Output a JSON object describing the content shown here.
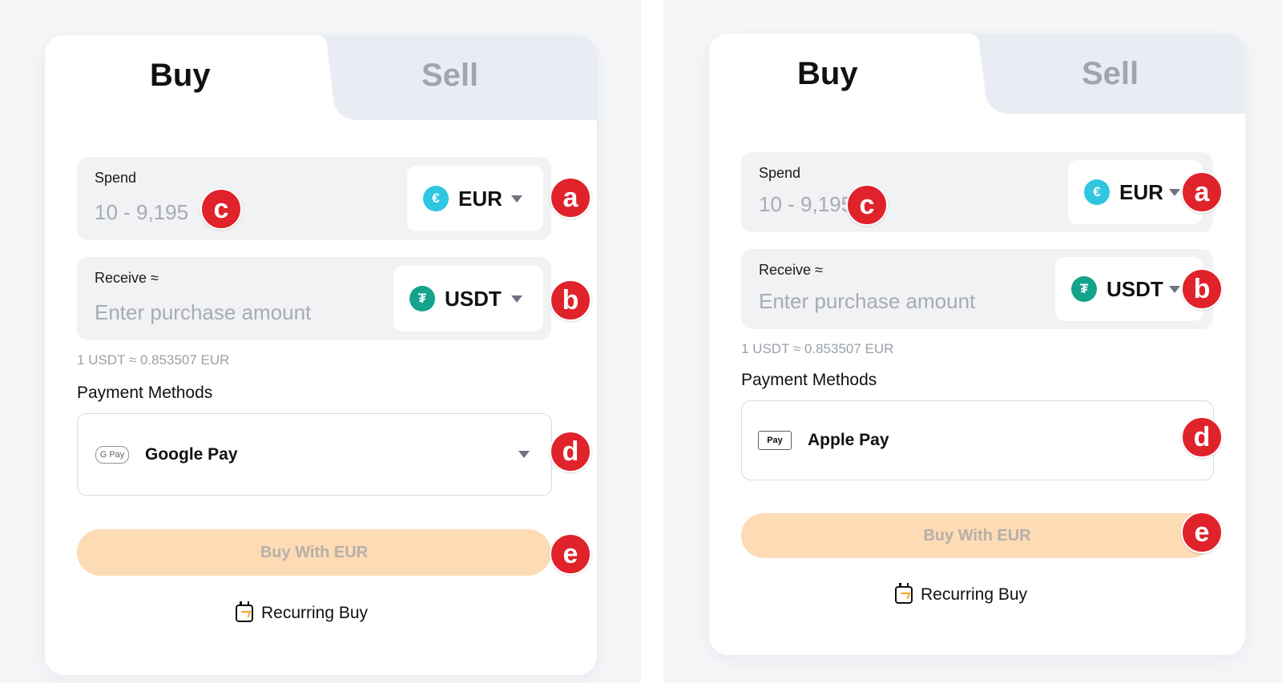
{
  "panels": {
    "left": {
      "tabs": {
        "buy": "Buy",
        "sell": "Sell"
      },
      "spend": {
        "label": "Spend",
        "placeholder": "10 - 9,195",
        "currency": "EUR",
        "coin_icon": "euro-coin-icon"
      },
      "receive": {
        "label": "Receive ≈",
        "placeholder": "Enter purchase amount",
        "currency": "USDT",
        "coin_icon": "tether-coin-icon"
      },
      "rate": "1 USDT ≈ 0.853507 EUR",
      "payment_methods_title": "Payment Methods",
      "payment_method": {
        "name": "Google Pay",
        "logo_text": "G Pay",
        "icon": "google-pay-icon"
      },
      "buy_button": "Buy With EUR",
      "recurring_buy": "Recurring Buy"
    },
    "right": {
      "tabs": {
        "buy": "Buy",
        "sell": "Sell"
      },
      "spend": {
        "label": "Spend",
        "placeholder": "10 - 9,195",
        "currency": "EUR",
        "coin_icon": "euro-coin-icon"
      },
      "receive": {
        "label": "Receive ≈",
        "placeholder": "Enter purchase amount",
        "currency": "USDT",
        "coin_icon": "tether-coin-icon"
      },
      "rate": "1 USDT ≈ 0.853507 EUR",
      "payment_methods_title": "Payment Methods",
      "payment_method": {
        "name": "Apple Pay",
        "logo_text": "Pay",
        "icon": "apple-pay-icon"
      },
      "buy_button": "Buy With EUR",
      "recurring_buy": "Recurring Buy"
    }
  },
  "markers": {
    "a": "a",
    "b": "b",
    "c": "c",
    "d": "d",
    "e": "e"
  },
  "colors": {
    "accent_marker": "#e0222b",
    "buy_button_bg": "#fddbb5",
    "eur_coin": "#2fc6e0",
    "usdt_coin": "#14a38b",
    "sell_tab_bg": "#e9edf3"
  },
  "coin_glyphs": {
    "eur": "€",
    "usdt": "₮"
  }
}
